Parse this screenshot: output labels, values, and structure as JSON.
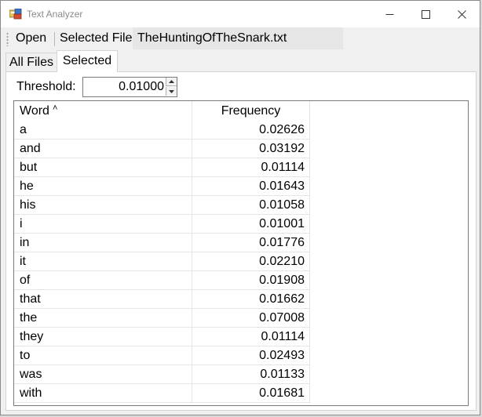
{
  "window": {
    "title": "Text Analyzer"
  },
  "toolbar": {
    "open_label": "Open",
    "selected_file_label": "Selected File:",
    "selected_file_value": "TheHuntingOfTheSnark.txt"
  },
  "tabs": [
    {
      "label": "All Files",
      "active": false
    },
    {
      "label": "Selected",
      "active": true
    }
  ],
  "threshold": {
    "label": "Threshold:",
    "value": "0.01000"
  },
  "table": {
    "columns": [
      "Word",
      "Frequency"
    ],
    "sort_indicator": "˄",
    "rows": [
      {
        "word": "a",
        "frequency": "0.02626"
      },
      {
        "word": "and",
        "frequency": "0.03192"
      },
      {
        "word": "but",
        "frequency": "0.01114"
      },
      {
        "word": "he",
        "frequency": "0.01643"
      },
      {
        "word": "his",
        "frequency": "0.01058"
      },
      {
        "word": "i",
        "frequency": "0.01001"
      },
      {
        "word": "in",
        "frequency": "0.01776"
      },
      {
        "word": "it",
        "frequency": "0.02210"
      },
      {
        "word": "of",
        "frequency": "0.01908"
      },
      {
        "word": "that",
        "frequency": "0.01662"
      },
      {
        "word": "the",
        "frequency": "0.07008"
      },
      {
        "word": "they",
        "frequency": "0.01114"
      },
      {
        "word": "to",
        "frequency": "0.02493"
      },
      {
        "word": "was",
        "frequency": "0.01133"
      },
      {
        "word": "with",
        "frequency": "0.01681"
      }
    ]
  },
  "colors": {
    "window_bg": "#f0f0f0",
    "titlebar_bg": "#ffffff",
    "title_text": "#8a8a8a",
    "file_field_bg": "#e6e6e6"
  }
}
